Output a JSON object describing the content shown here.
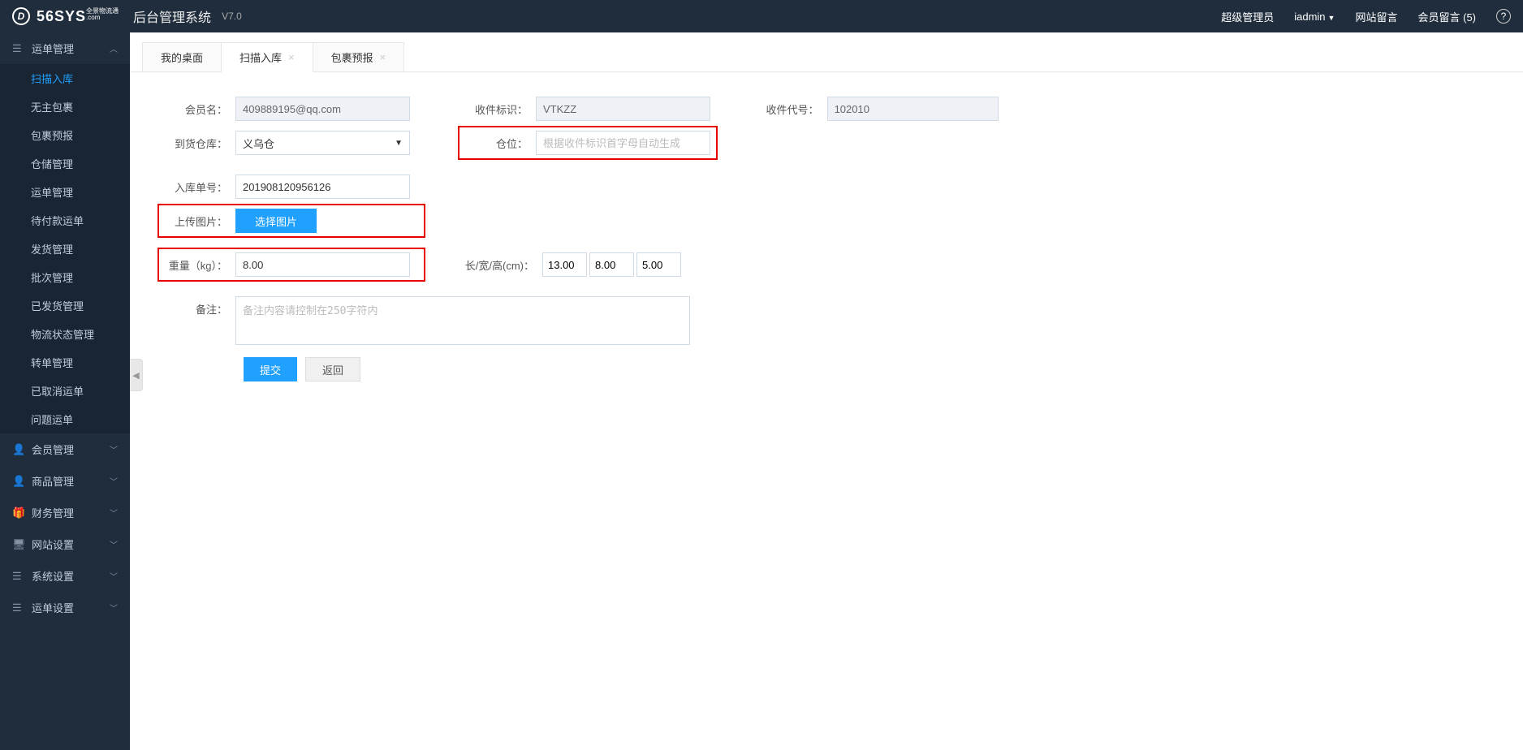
{
  "header": {
    "logo_main": "56SYS",
    "logo_sub_top": "全景物流通",
    "logo_sub_bottom": ".com",
    "app_title": "后台管理系统",
    "version": "V7.0",
    "role": "超级管理员",
    "user": "iadmin",
    "site_msg": "网站留言",
    "member_msg": "会员留言",
    "member_msg_count": "(5)"
  },
  "sidebar": {
    "groups": [
      {
        "label": "运单管理",
        "expanded": true
      },
      {
        "label": "会员管理",
        "expanded": false
      },
      {
        "label": "商品管理",
        "expanded": false
      },
      {
        "label": "财务管理",
        "expanded": false
      },
      {
        "label": "网站设置",
        "expanded": false
      },
      {
        "label": "系统设置",
        "expanded": false
      },
      {
        "label": "运单设置",
        "expanded": false
      }
    ],
    "sub_items": [
      "扫描入库",
      "无主包裹",
      "包裹预报",
      "仓储管理",
      "运单管理",
      "待付款运单",
      "发货管理",
      "批次管理",
      "已发货管理",
      "物流状态管理",
      "转单管理",
      "已取消运单",
      "问题运单"
    ]
  },
  "tabs": [
    {
      "label": "我的桌面",
      "closable": false,
      "active": false
    },
    {
      "label": "扫描入库",
      "closable": true,
      "active": true
    },
    {
      "label": "包裹预报",
      "closable": true,
      "active": false
    }
  ],
  "form": {
    "member_name_label": "会员名：",
    "member_name_value": "409889195@qq.com",
    "recv_mark_label": "收件标识：",
    "recv_mark_value": "VTKZZ",
    "recv_code_label": "收件代号：",
    "recv_code_value": "102010",
    "warehouse_label": "到货仓库：",
    "warehouse_value": "义乌仓",
    "slot_label": "仓位：",
    "slot_placeholder": "根据收件标识首字母自动生成",
    "in_no_label": "入库单号：",
    "in_no_value": "201908120956126",
    "upload_label": "上传图片：",
    "upload_btn": "选择图片",
    "weight_label": "重量（kg）：",
    "weight_value": "8.00",
    "dim_label": "长/宽/高(cm)：",
    "dim_l": "13.00",
    "dim_w": "8.00",
    "dim_h": "5.00",
    "remark_label": "备注：",
    "remark_placeholder": "备注内容请控制在250字符内",
    "submit_btn": "提交",
    "back_btn": "返回"
  }
}
